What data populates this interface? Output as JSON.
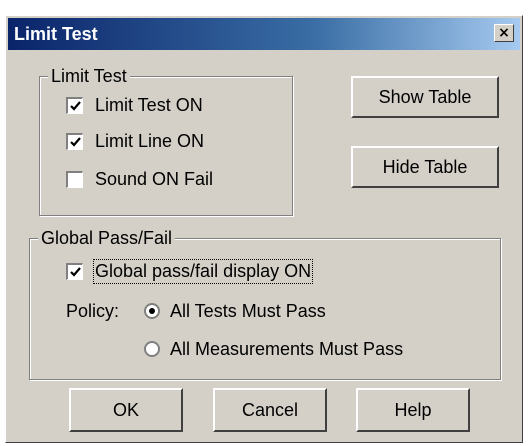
{
  "window": {
    "title": "Limit Test",
    "close_glyph": "×"
  },
  "limit_group": {
    "label": "Limit Test",
    "items": [
      {
        "label": "Limit Test ON",
        "checked": true
      },
      {
        "label": "Limit Line ON",
        "checked": true
      },
      {
        "label": "Sound ON Fail",
        "checked": false
      }
    ]
  },
  "side_buttons": {
    "show_table": "Show Table",
    "hide_table": "Hide Table"
  },
  "global_group": {
    "label": "Global Pass/Fail",
    "display_label": "Global pass/fail display ON",
    "display_checked": true,
    "policy_label": "Policy:",
    "policy_options": [
      {
        "label": "All Tests Must Pass",
        "selected": true
      },
      {
        "label": "All Measurements Must Pass",
        "selected": false
      }
    ]
  },
  "footer": {
    "ok": "OK",
    "cancel": "Cancel",
    "help": "Help"
  }
}
